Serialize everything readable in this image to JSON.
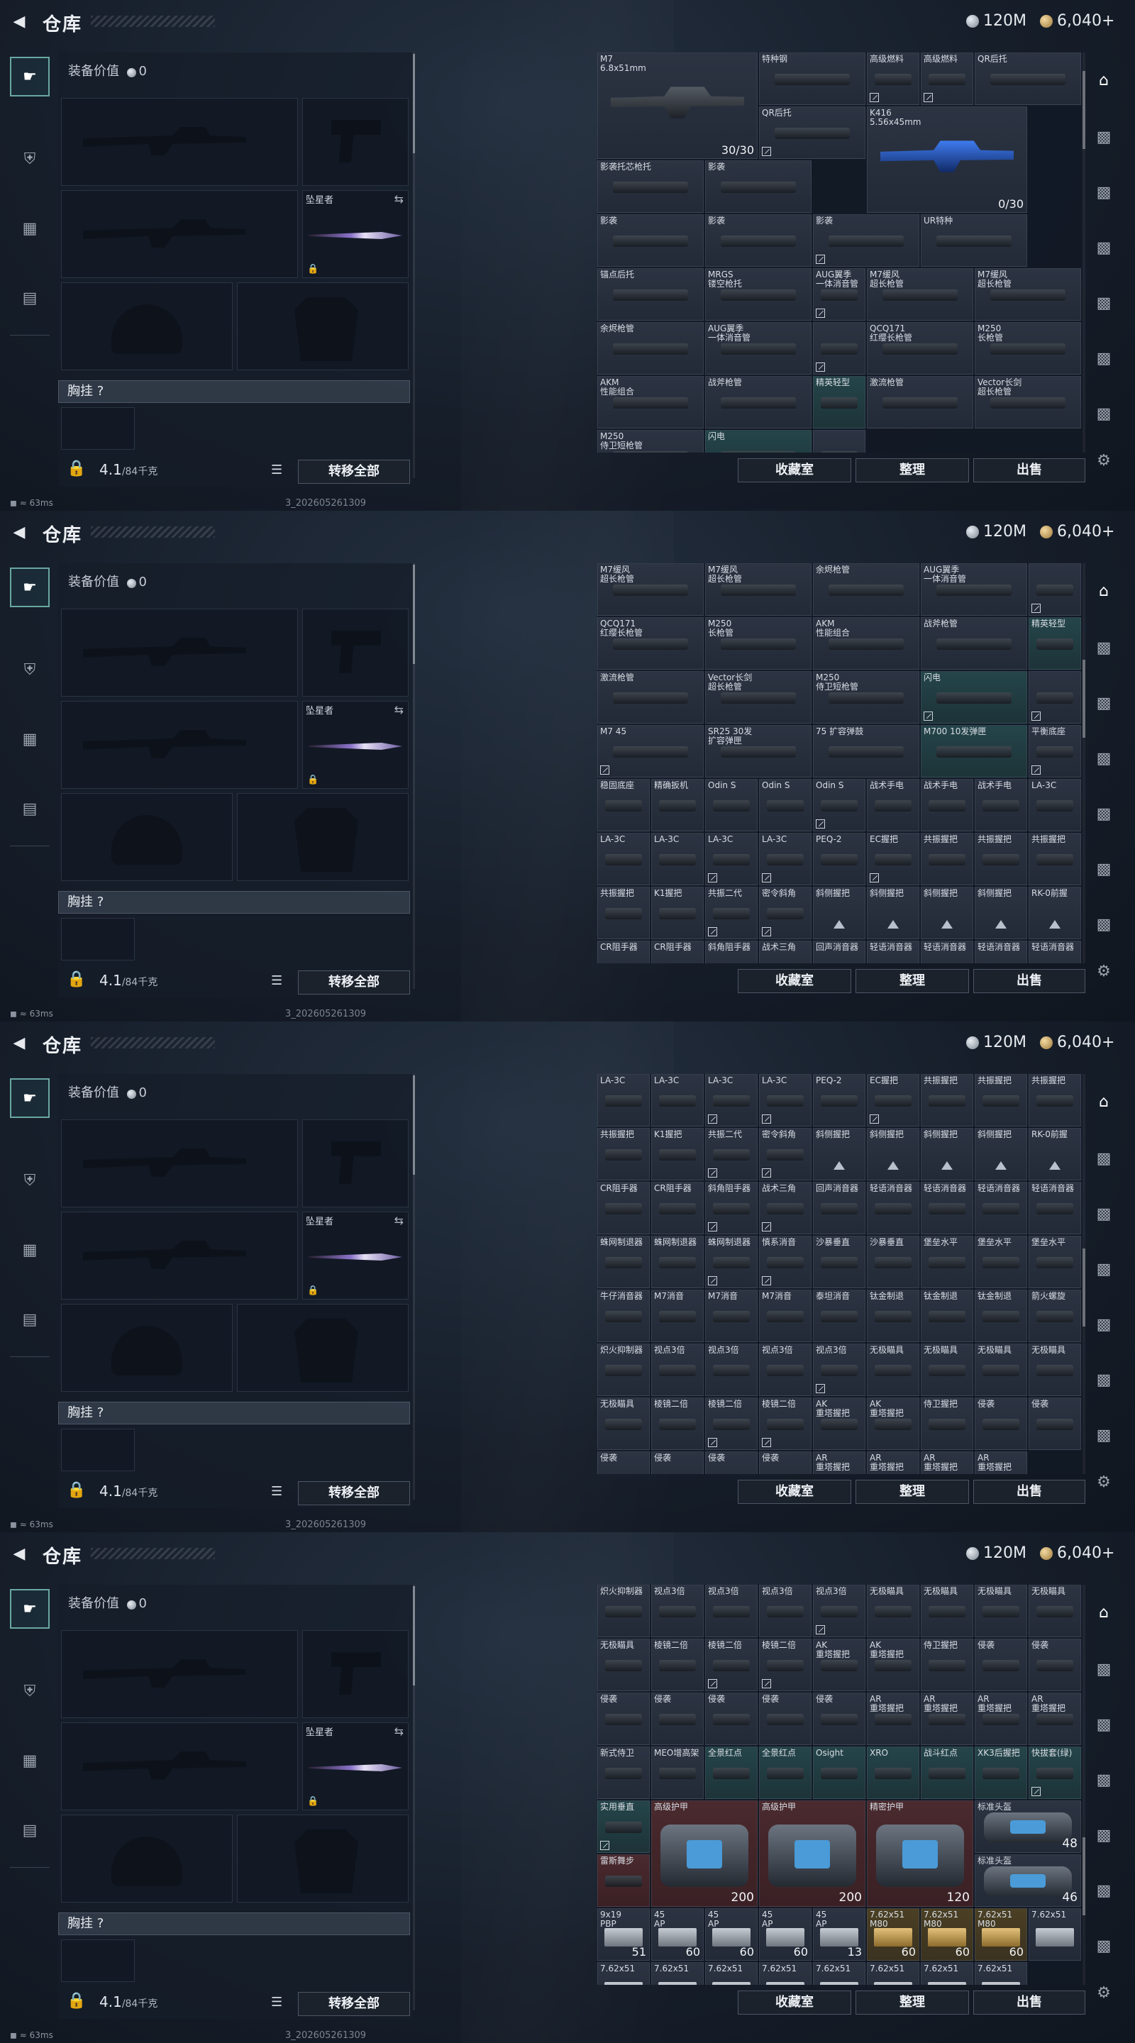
{
  "header": {
    "title": "仓库",
    "silver": "120M",
    "gold": "6,040+"
  },
  "left": {
    "equip_value_label": "装备价值",
    "equip_value": "0",
    "knife_name": "坠星者",
    "chest_label": "胸挂 ?",
    "weight": "4.1",
    "weight_max": "/84千克",
    "transfer_all": "转移全部"
  },
  "status": {
    "ping": "63ms",
    "build": "3_202605261309"
  },
  "buttons": {
    "collection": "收藏室",
    "sort": "整理",
    "sell": "出售"
  },
  "icons": {
    "back": "back-arrow-icon",
    "silver": "silver-coin-icon",
    "gold": "gold-coin-icon",
    "settings": "gear-icon"
  },
  "frames": [
    {
      "cells": [
        {
          "name": "M7\n6.8x51mm",
          "w": 3,
          "h": 2,
          "img": "rifle",
          "count": "30/30"
        },
        {
          "name": "特种钢",
          "w": 2,
          "img": "part"
        },
        {
          "name": "高级燃料",
          "img": "part",
          "mark": true
        },
        {
          "name": "高级燃料",
          "img": "part",
          "mark": true
        },
        {
          "name": "QR后托",
          "w": 2,
          "img": "part"
        },
        {
          "name": "QR后托",
          "w": 2,
          "img": "part",
          "mark": true
        },
        {
          "name": "K416\n5.56x45mm",
          "w": 3,
          "h": 2,
          "img": "rifle-blue",
          "count": "0/30"
        },
        {
          "name": "影袭托芯枪托",
          "w": 2,
          "img": "part"
        },
        {
          "name": "影袭",
          "w": 2,
          "img": "part"
        },
        {
          "name": "影袭",
          "w": 2,
          "img": "part"
        },
        {
          "name": "影袭",
          "w": 2,
          "img": "part"
        },
        {
          "name": "影袭",
          "w": 2,
          "img": "part",
          "mark": true
        },
        {
          "name": "UR特种",
          "w": 2,
          "img": "part"
        },
        {
          "name": "锚点后托",
          "w": 2,
          "img": "part"
        },
        {
          "name": "MRGS\n镂空枪托",
          "w": 2,
          "img": "part"
        },
        {
          "name": "AUG翼季\n一体消音管",
          "img": "part",
          "mark": true
        },
        {
          "name": "M7缓风\n超长枪管",
          "w": 2,
          "img": "part"
        },
        {
          "name": "M7缓风\n超长枪管",
          "w": 2,
          "img": "part"
        },
        {
          "name": "余烬枪管",
          "w": 2,
          "img": "part"
        },
        {
          "name": "AUG翼季\n一体消音管",
          "w": 2,
          "img": "part"
        },
        {
          "name": "",
          "img": "part",
          "mark": true
        },
        {
          "name": "QCQ171\n红缨长枪管",
          "w": 2,
          "img": "part"
        },
        {
          "name": "M250\n长枪管",
          "w": 2,
          "img": "part"
        },
        {
          "name": "AKM\n性能组合",
          "w": 2,
          "img": "part"
        },
        {
          "name": "战斧枪管",
          "w": 2,
          "img": "part"
        },
        {
          "name": "精英轻型",
          "img": "part",
          "teal": true
        },
        {
          "name": "激流枪管",
          "w": 2,
          "img": "part"
        },
        {
          "name": "Vector长剑\n超长枪管",
          "w": 2,
          "img": "part"
        },
        {
          "name": "M250\n侍卫短枪管",
          "w": 2,
          "img": "part"
        },
        {
          "name": "闪电",
          "w": 2,
          "img": "part",
          "teal": true
        },
        {
          "name": "",
          "img": "part"
        }
      ]
    },
    {
      "cells": [
        {
          "name": "M7缓风\n超长枪管",
          "w": 2,
          "img": "part"
        },
        {
          "name": "M7缓风\n超长枪管",
          "w": 2,
          "img": "part"
        },
        {
          "name": "余烬枪管",
          "w": 2,
          "img": "part"
        },
        {
          "name": "AUG翼季\n一体消音管",
          "w": 2,
          "img": "part"
        },
        {
          "name": "",
          "img": "part",
          "mark": true
        },
        {
          "name": "QCQ171\n红缨长枪管",
          "w": 2,
          "img": "part"
        },
        {
          "name": "M250\n长枪管",
          "w": 2,
          "img": "part"
        },
        {
          "name": "AKM\n性能组合",
          "w": 2,
          "img": "part"
        },
        {
          "name": "战斧枪管",
          "w": 2,
          "img": "part"
        },
        {
          "name": "精英轻型",
          "img": "part",
          "teal": true
        },
        {
          "name": "激流枪管",
          "w": 2,
          "img": "part"
        },
        {
          "name": "Vector长剑\n超长枪管",
          "w": 2,
          "img": "part"
        },
        {
          "name": "M250\n侍卫短枪管",
          "w": 2,
          "img": "part"
        },
        {
          "name": "闪电",
          "w": 2,
          "img": "part",
          "teal": true,
          "mark": true
        },
        {
          "name": "",
          "img": "part",
          "mark": true
        },
        {
          "name": "M7 45",
          "w": 2,
          "img": "part",
          "mark": true
        },
        {
          "name": "SR25 30发\n扩容弹匣",
          "w": 2,
          "img": "part"
        },
        {
          "name": "75 扩容弹鼓",
          "w": 2,
          "img": "part"
        },
        {
          "name": "M700 10发弹匣",
          "w": 2,
          "img": "part",
          "teal": true
        },
        {
          "name": "平衡底座",
          "img": "part",
          "mark": true
        },
        {
          "name": "稳固底座",
          "img": "part"
        },
        {
          "name": "精确扳机",
          "img": "part"
        },
        {
          "name": "Odin S",
          "img": "part"
        },
        {
          "name": "Odin S",
          "img": "part"
        },
        {
          "name": "Odin S",
          "img": "part",
          "mark": true
        },
        {
          "name": "战术手电",
          "img": "part"
        },
        {
          "name": "战术手电",
          "img": "part"
        },
        {
          "name": "战术手电",
          "img": "part"
        },
        {
          "name": "LA-3C",
          "img": "part"
        },
        {
          "name": "LA-3C",
          "img": "part"
        },
        {
          "name": "LA-3C",
          "img": "part"
        },
        {
          "name": "LA-3C",
          "img": "part",
          "mark": true
        },
        {
          "name": "LA-3C",
          "img": "part",
          "mark": true
        },
        {
          "name": "PEQ-2",
          "img": "part"
        },
        {
          "name": "EC握把",
          "img": "part",
          "mark": true
        },
        {
          "name": "共振握把",
          "img": "part"
        },
        {
          "name": "共振握把",
          "img": "part"
        },
        {
          "name": "共振握把",
          "img": "part"
        },
        {
          "name": "共振握把",
          "img": "part"
        },
        {
          "name": "K1握把",
          "img": "part"
        },
        {
          "name": "共振二代",
          "img": "part",
          "mark": true
        },
        {
          "name": "密令斜角",
          "img": "part",
          "mark": true
        },
        {
          "name": "斜侧握把",
          "img": "tri"
        },
        {
          "name": "斜侧握把",
          "img": "tri"
        },
        {
          "name": "斜侧握把",
          "img": "tri"
        },
        {
          "name": "斜侧握把",
          "img": "tri"
        },
        {
          "name": "RK-0前握",
          "img": "tri"
        },
        {
          "name": "CR阻手器",
          "img": "tri"
        },
        {
          "name": "CR阻手器",
          "img": "tri"
        },
        {
          "name": "斜角阻手器",
          "img": "tri"
        },
        {
          "name": "战术三角",
          "img": "tri"
        },
        {
          "name": "回声消音器",
          "img": "tri"
        },
        {
          "name": "轻语消音器",
          "img": "tri"
        },
        {
          "name": "轻语消音器",
          "img": "tri"
        },
        {
          "name": "轻语消音器",
          "img": "tri"
        },
        {
          "name": "轻语消音器",
          "img": "tri"
        }
      ]
    },
    {
      "cells": [
        {
          "name": "LA-3C",
          "img": "part"
        },
        {
          "name": "LA-3C",
          "img": "part"
        },
        {
          "name": "LA-3C",
          "img": "part",
          "mark": true
        },
        {
          "name": "LA-3C",
          "img": "part",
          "mark": true
        },
        {
          "name": "PEQ-2",
          "img": "part"
        },
        {
          "name": "EC握把",
          "img": "part",
          "mark": true
        },
        {
          "name": "共振握把",
          "img": "part"
        },
        {
          "name": "共振握把",
          "img": "part"
        },
        {
          "name": "共振握把",
          "img": "part"
        },
        {
          "name": "共振握把",
          "img": "part"
        },
        {
          "name": "K1握把",
          "img": "part"
        },
        {
          "name": "共振二代",
          "img": "part",
          "mark": true
        },
        {
          "name": "密令斜角",
          "img": "part",
          "mark": true
        },
        {
          "name": "斜侧握把",
          "img": "tri"
        },
        {
          "name": "斜侧握把",
          "img": "tri"
        },
        {
          "name": "斜侧握把",
          "img": "tri"
        },
        {
          "name": "斜侧握把",
          "img": "tri"
        },
        {
          "name": "RK-0前握",
          "img": "tri"
        },
        {
          "name": "CR阻手器",
          "img": "part"
        },
        {
          "name": "CR阻手器",
          "img": "part"
        },
        {
          "name": "斜角阻手器",
          "img": "part",
          "mark": true
        },
        {
          "name": "战术三角",
          "img": "part",
          "mark": true
        },
        {
          "name": "回声消音器",
          "img": "part"
        },
        {
          "name": "轻语消音器",
          "img": "part"
        },
        {
          "name": "轻语消音器",
          "img": "part"
        },
        {
          "name": "轻语消音器",
          "img": "part"
        },
        {
          "name": "轻语消音器",
          "img": "part"
        },
        {
          "name": "蛛网制退器",
          "img": "part"
        },
        {
          "name": "蛛网制退器",
          "img": "part"
        },
        {
          "name": "蛛网制退器",
          "img": "part",
          "mark": true
        },
        {
          "name": "慎系消音",
          "img": "part",
          "mark": true
        },
        {
          "name": "沙暴垂直",
          "img": "part"
        },
        {
          "name": "沙暴垂直",
          "img": "part"
        },
        {
          "name": "堡垒水平",
          "img": "part"
        },
        {
          "name": "堡垒水平",
          "img": "part"
        },
        {
          "name": "堡垒水平",
          "img": "part"
        },
        {
          "name": "牛仔消音器",
          "img": "part"
        },
        {
          "name": "M7消音",
          "img": "part"
        },
        {
          "name": "M7消音",
          "img": "part"
        },
        {
          "name": "M7消音",
          "img": "part"
        },
        {
          "name": "泰坦消音",
          "img": "part"
        },
        {
          "name": "钛金制退",
          "img": "part"
        },
        {
          "name": "钛金制退",
          "img": "part"
        },
        {
          "name": "钛金制退",
          "img": "part"
        },
        {
          "name": "箭火螺旋",
          "img": "part"
        },
        {
          "name": "炽火抑制器",
          "img": "part"
        },
        {
          "name": "视点3倍",
          "img": "part"
        },
        {
          "name": "视点3倍",
          "img": "part"
        },
        {
          "name": "视点3倍",
          "img": "part"
        },
        {
          "name": "视点3倍",
          "img": "part",
          "mark": true
        },
        {
          "name": "无极瞄具",
          "img": "part"
        },
        {
          "name": "无极瞄具",
          "img": "part"
        },
        {
          "name": "无极瞄具",
          "img": "part"
        },
        {
          "name": "无极瞄具",
          "img": "part"
        },
        {
          "name": "无极瞄具",
          "img": "part"
        },
        {
          "name": "棱镜二倍",
          "img": "part"
        },
        {
          "name": "棱镜二倍",
          "img": "part",
          "mark": true
        },
        {
          "name": "棱镜二倍",
          "img": "part",
          "mark": true
        },
        {
          "name": "AK\n重塔握把",
          "img": "part"
        },
        {
          "name": "AK\n重塔握把",
          "img": "part"
        },
        {
          "name": "侍卫握把",
          "img": "part"
        },
        {
          "name": "侵袭",
          "img": "part"
        },
        {
          "name": "侵袭",
          "img": "part"
        },
        {
          "name": "侵袭",
          "img": "tri"
        },
        {
          "name": "侵袭",
          "img": "tri"
        },
        {
          "name": "侵袭",
          "img": "tri"
        },
        {
          "name": "侵袭",
          "img": "tri"
        },
        {
          "name": "AR\n重塔握把",
          "img": "tri"
        },
        {
          "name": "AR\n重塔握把",
          "img": "tri"
        },
        {
          "name": "AR\n重塔握把",
          "img": "tri"
        },
        {
          "name": "AR\n重塔握把",
          "img": "tri"
        }
      ]
    },
    {
      "cells": [
        {
          "name": "炽火抑制器",
          "img": "part"
        },
        {
          "name": "视点3倍",
          "img": "part"
        },
        {
          "name": "视点3倍",
          "img": "part"
        },
        {
          "name": "视点3倍",
          "img": "part"
        },
        {
          "name": "视点3倍",
          "img": "part",
          "mark": true
        },
        {
          "name": "无极瞄具",
          "img": "part"
        },
        {
          "name": "无极瞄具",
          "img": "part"
        },
        {
          "name": "无极瞄具",
          "img": "part"
        },
        {
          "name": "无极瞄具",
          "img": "part"
        },
        {
          "name": "无极瞄具",
          "img": "part"
        },
        {
          "name": "棱镜二倍",
          "img": "part"
        },
        {
          "name": "棱镜二倍",
          "img": "part",
          "mark": true
        },
        {
          "name": "棱镜二倍",
          "img": "part",
          "mark": true
        },
        {
          "name": "AK\n重塔握把",
          "img": "part"
        },
        {
          "name": "AK\n重塔握把",
          "img": "part"
        },
        {
          "name": "侍卫握把",
          "img": "part"
        },
        {
          "name": "侵袭",
          "img": "part"
        },
        {
          "name": "侵袭",
          "img": "part"
        },
        {
          "name": "侵袭",
          "img": "part"
        },
        {
          "name": "侵袭",
          "img": "part"
        },
        {
          "name": "侵袭",
          "img": "part"
        },
        {
          "name": "侵袭",
          "img": "part"
        },
        {
          "name": "侵袭",
          "img": "part"
        },
        {
          "name": "AR\n重塔握把",
          "img": "part"
        },
        {
          "name": "AR\n重塔握把",
          "img": "part"
        },
        {
          "name": "AR\n重塔握把",
          "img": "part"
        },
        {
          "name": "AR\n重塔握把",
          "img": "part"
        },
        {
          "name": "新式侍卫",
          "img": "part"
        },
        {
          "name": "MEO增高架",
          "img": "part"
        },
        {
          "name": "全景红点",
          "img": "part",
          "teal": true
        },
        {
          "name": "全景红点",
          "img": "part",
          "teal": true
        },
        {
          "name": "Osight",
          "img": "part",
          "teal": true
        },
        {
          "name": "XRO",
          "img": "part",
          "teal": true
        },
        {
          "name": "战斗红点",
          "img": "part",
          "teal": true
        },
        {
          "name": "XK3后握把",
          "img": "part",
          "teal": true
        },
        {
          "name": "快拔套(绿)",
          "img": "part",
          "teal": true,
          "mark": true
        },
        {
          "name": "实用垂直",
          "img": "part",
          "teal": true,
          "mark": true
        },
        {
          "name": "高级护甲",
          "w": 2,
          "h": 2,
          "img": "kit",
          "red": true,
          "dur": "200"
        },
        {
          "name": "高级护甲",
          "w": 2,
          "h": 2,
          "img": "kit",
          "red": true,
          "dur": "200"
        },
        {
          "name": "精密护甲",
          "w": 2,
          "h": 2,
          "img": "kit",
          "red": true,
          "dur": "120"
        },
        {
          "name": "标准头盔",
          "w": 2,
          "img": "kit",
          "dur": "48"
        },
        {
          "name": "雷斯舞步",
          "img": "part",
          "red": true
        },
        {
          "name": "标准头盔",
          "w": 2,
          "img": "kit",
          "dur": "46"
        },
        {
          "name": "9x19\nPBP",
          "img": "ammo",
          "count": "51"
        },
        {
          "name": "45\nAP",
          "img": "ammo",
          "count": "60"
        },
        {
          "name": "45\nAP",
          "img": "ammo",
          "count": "60"
        },
        {
          "name": "45\nAP",
          "img": "ammo",
          "count": "60"
        },
        {
          "name": "45\nAP",
          "img": "ammo",
          "count": "13"
        },
        {
          "name": "7.62x51\nM80",
          "img": "ammo-gold",
          "gold": true,
          "count": "60"
        },
        {
          "name": "7.62x51\nM80",
          "img": "ammo-gold",
          "gold": true,
          "count": "60"
        },
        {
          "name": "7.62x51\nM80",
          "img": "ammo-gold",
          "gold": true,
          "count": "60"
        },
        {
          "name": "7.62x51",
          "img": "ammo"
        },
        {
          "name": "7.62x51",
          "img": "ammo"
        },
        {
          "name": "7.62x51",
          "img": "ammo"
        },
        {
          "name": "7.62x51",
          "img": "ammo"
        },
        {
          "name": "7.62x51",
          "img": "ammo"
        },
        {
          "name": "7.62x51",
          "img": "ammo"
        },
        {
          "name": "7.62x51",
          "img": "ammo"
        },
        {
          "name": "7.62x51",
          "img": "ammo"
        },
        {
          "name": "7.62x51",
          "img": "ammo"
        }
      ]
    }
  ]
}
